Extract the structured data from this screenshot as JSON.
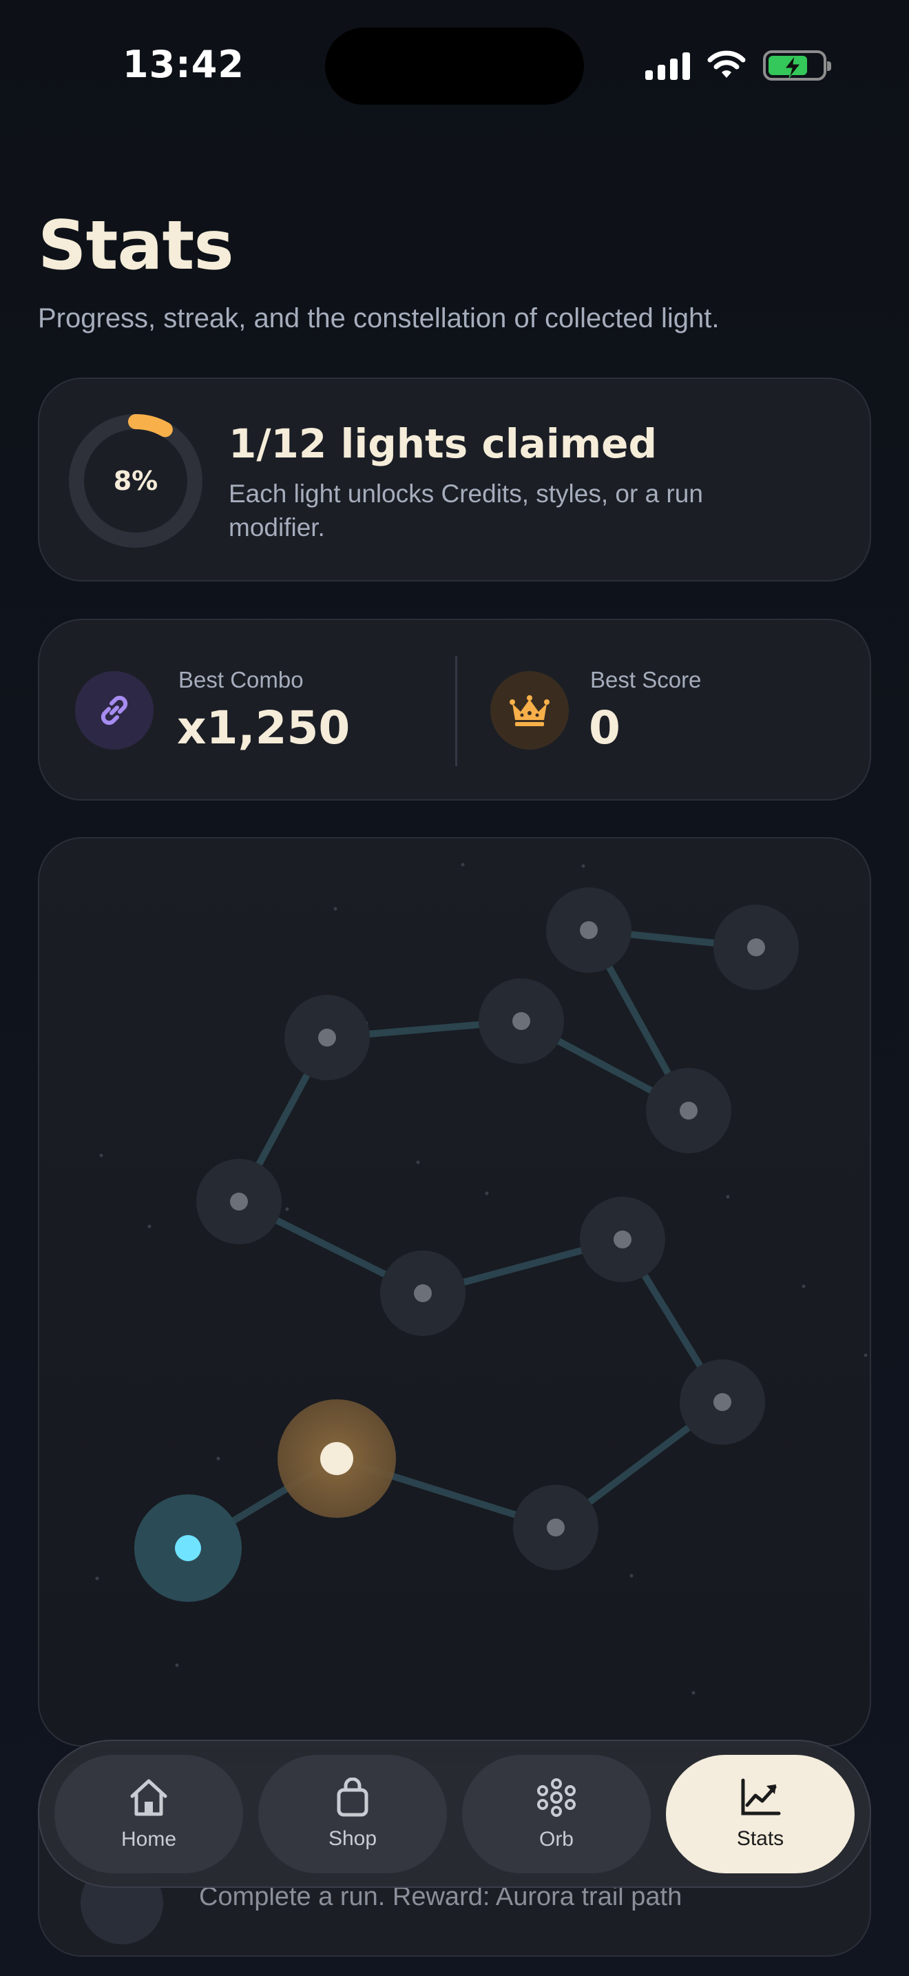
{
  "status_bar": {
    "time": "13:42",
    "icons": [
      "signal-icon",
      "wifi-icon",
      "battery-charging-icon"
    ]
  },
  "header": {
    "title": "Stats",
    "subtitle": "Progress, streak, and the constellation of collected light."
  },
  "progress_card": {
    "percent_label": "8%",
    "progress_fraction": 0.083,
    "title": "1/12 lights claimed",
    "description": "Each light unlocks Credits, styles, or a run modifier."
  },
  "best_card": {
    "combo": {
      "label": "Best Combo",
      "value": "x1,250",
      "icon": "link-icon"
    },
    "score": {
      "label": "Best Score",
      "value": "0",
      "icon": "crown-icon"
    }
  },
  "constellation": {
    "total_lights": 12,
    "claimed_lights": 1
  },
  "reward_card": {
    "text": "Complete a run. Reward: Aurora trail path"
  },
  "nav": {
    "items": [
      {
        "label": "Home",
        "icon": "home-icon",
        "active": false
      },
      {
        "label": "Shop",
        "icon": "shopping-bag-icon",
        "active": false
      },
      {
        "label": "Orb",
        "icon": "orb-icon",
        "active": false
      },
      {
        "label": "Stats",
        "icon": "chart-icon",
        "active": true
      }
    ]
  },
  "colors": {
    "background": "#0f131b",
    "card": "#1b1e25",
    "accent_orange": "#f8b04a",
    "accent_cyan": "#6fe3ff",
    "cream": "#f5ecd9",
    "purple": "#a68cf0"
  }
}
